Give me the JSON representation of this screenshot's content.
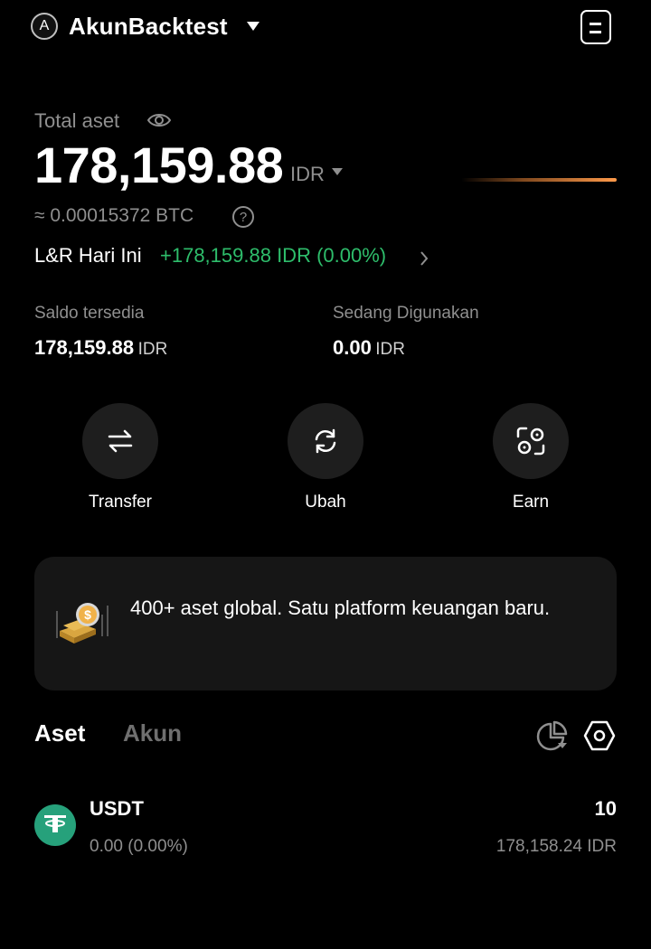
{
  "header": {
    "avatar_letter": "A",
    "account_name": "AkunBacktest"
  },
  "balance": {
    "label": "Total aset",
    "value": "178,159.88",
    "currency": "IDR",
    "btc_equivalent": "≈ 0.00015372 BTC",
    "pnl_label": "L&R Hari Ini",
    "pnl_value": "+178,159.88 IDR (0.00%)"
  },
  "balances": {
    "available_label": "Saldo tersedia",
    "available_value": "178,159.88",
    "available_currency": "IDR",
    "in_use_label": "Sedang Digunakan",
    "in_use_value": "0.00",
    "in_use_currency": "IDR"
  },
  "actions": [
    {
      "label": "Transfer",
      "icon": "transfer-arrows-icon"
    },
    {
      "label": "Ubah",
      "icon": "convert-refresh-icon"
    },
    {
      "label": "Earn",
      "icon": "earn-coins-icon"
    }
  ],
  "banner": {
    "text": "400+ aset global. Satu platform keuangan baru.",
    "icon": "gold-bars-coin-icon"
  },
  "tabs": [
    {
      "label": "Aset",
      "active": true
    },
    {
      "label": "Akun",
      "active": false
    }
  ],
  "assets": [
    {
      "symbol": "USDT",
      "pnl": "0.00 (0.00%)",
      "quantity": "10",
      "value": "178,158.24 IDR",
      "icon": "tether-icon",
      "color": "#26a17b"
    }
  ],
  "colors": {
    "background": "#000000",
    "positive": "#2ebd6b",
    "accent": "#ff9a4a",
    "muted": "#8f8f8f"
  }
}
